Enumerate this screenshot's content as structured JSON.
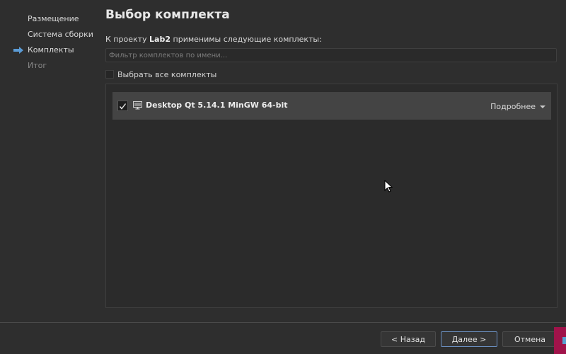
{
  "sidebar": {
    "steps": [
      {
        "label": "Размещение",
        "state": "done"
      },
      {
        "label": "Система сборки",
        "state": "done"
      },
      {
        "label": "Комплекты",
        "state": "current"
      },
      {
        "label": "Итог",
        "state": "pending"
      }
    ],
    "current_marker_icon": "arrow-right-icon"
  },
  "main": {
    "title": "Выбор комплекта",
    "intro_prefix": "К проекту",
    "project_name": "Lab2",
    "intro_suffix": "применимы следующие комплекты:",
    "filter_placeholder": "Фильтр комплектов по имени...",
    "select_all_label": "Выбрать все комплекты",
    "select_all_checked": false,
    "kits": [
      {
        "name": "Desktop Qt 5.14.1 MinGW 64-bit",
        "checked": true,
        "icon": "monitor-icon",
        "details_label": "Подробнее"
      }
    ]
  },
  "footer": {
    "back_label": "< Назад",
    "next_label": "Далее >",
    "cancel_label": "Отмена"
  },
  "colors": {
    "background": "#2e2e2e",
    "kit_row": "#444444",
    "accent_arrow": "#5b9bd5",
    "default_button_border": "#6b8fc0",
    "corner_badge": "#a0134a"
  }
}
